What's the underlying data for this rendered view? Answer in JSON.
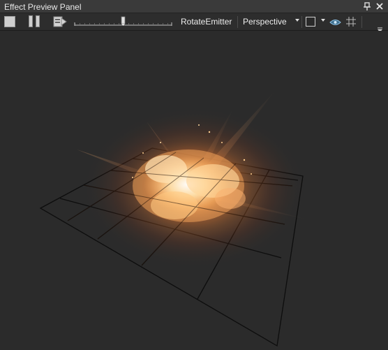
{
  "window": {
    "title": "Effect Preview Panel",
    "pin_icon": "pin-icon",
    "close_icon": "close-icon"
  },
  "toolbar": {
    "stop_icon": "stop-icon",
    "pause_icon": "pause-icon",
    "step_icon": "step-forward-icon",
    "playback_position": 0.5,
    "rotate_emitter_label": "RotateEmitter",
    "camera_mode": "Perspective",
    "background_color": "#2a2a2a",
    "eye_icon": "eye-icon",
    "grid_icon": "grid-icon",
    "overflow_icon": "overflow-menu-icon"
  },
  "viewport": {
    "background": "#2b2b2b",
    "effect": "fire-burst",
    "grid_visible": true
  }
}
